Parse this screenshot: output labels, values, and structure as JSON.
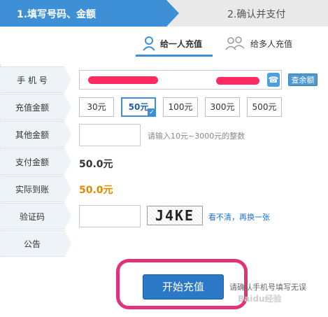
{
  "steps": {
    "step1": "1.填写号码、金额",
    "step2": "2.确认并支付"
  },
  "mode": {
    "single": "给一人充值",
    "multi": "给多人充值"
  },
  "labels": {
    "phone": "手 机 号",
    "recharge_amount": "充值金额",
    "other_amount": "其他金额",
    "pay_amount": "支付金额",
    "actual_amount": "实际到账",
    "captcha": "验证码",
    "notice": "公告"
  },
  "phone": {
    "query_button": "查余额"
  },
  "amounts": [
    "30元",
    "50元",
    "100元",
    "300元",
    "500元"
  ],
  "selected_amount": "50元",
  "other": {
    "hint": "请输入10元~3000元的整数"
  },
  "values": {
    "pay": "50.0元",
    "actual": "50.0元"
  },
  "captcha": {
    "code": "J4KE",
    "refresh": "看不清，再换一张"
  },
  "submit": {
    "label": "开始充值",
    "note": "请确认手机号填写无误"
  },
  "watermark": "Baidu经验",
  "colors": {
    "accent": "#3d8fd6",
    "highlight": "#e0337a",
    "amount_orange": "#e08a00"
  }
}
